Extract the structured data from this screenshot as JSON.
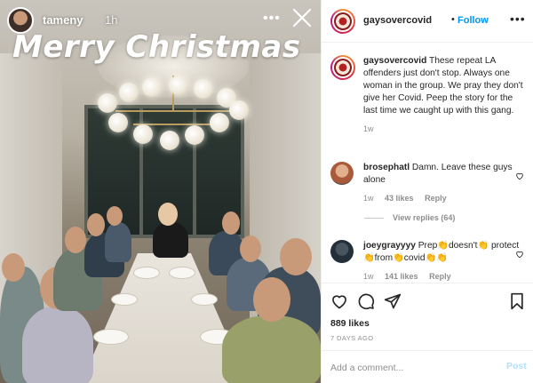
{
  "story": {
    "username": "tameny",
    "time": "1h",
    "more_glyph": "•••",
    "caption": "Merry Christmas",
    "photo_icon": "dinner-party-photo"
  },
  "post": {
    "username": "gaysovercovid",
    "dot": "•",
    "follow_label": "Follow",
    "more_glyph": "•••",
    "caption_user": "gaysovercovid",
    "caption_text": "These repeat LA offenders just don't stop. Always one woman in the group. We pray they don't give her Covid. Peep the story for the last time we caught up with this gang.",
    "caption_age": "1w"
  },
  "comments": [
    {
      "user": "brosephatl",
      "text": "Damn. Leave these guys alone",
      "age": "1w",
      "likes": "43 likes",
      "reply_label": "Reply",
      "view_replies": "View replies (64)"
    },
    {
      "user": "joeygrayyyy",
      "text": "Prep👏doesn't👏 protect👏from👏covid👏👏",
      "age": "1w",
      "likes": "141 likes",
      "reply_label": "Reply"
    }
  ],
  "actions": {
    "likes": "889 likes",
    "date": "7 DAYS AGO",
    "icons": [
      "heart-icon",
      "comment-icon",
      "share-icon",
      "bookmark-icon"
    ]
  },
  "compose": {
    "placeholder": "Add a comment...",
    "post_label": "Post"
  },
  "colors": {
    "accent": "#0095f6",
    "muted": "#8e8e8e",
    "post_disabled": "#b2dffc"
  }
}
